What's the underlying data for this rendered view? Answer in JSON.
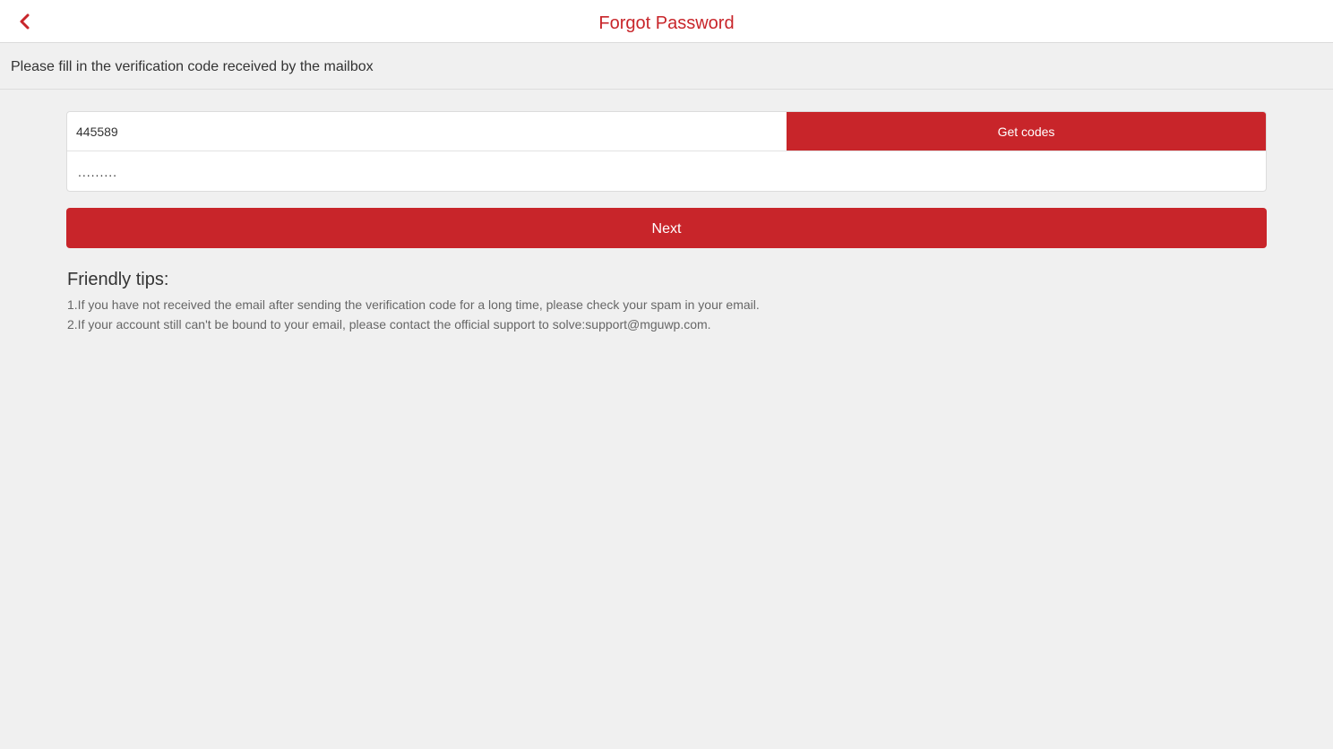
{
  "header": {
    "title": "Forgot Password",
    "back_icon": "chevron-left-icon",
    "accent_color": "#c8252a"
  },
  "subheader": {
    "text": "Please fill in the verification code received by the mailbox"
  },
  "form": {
    "code_value": "445589",
    "get_codes_label": "Get codes",
    "password_value": "........."
  },
  "next_label": "Next",
  "tips": {
    "title": "Friendly tips:",
    "items": [
      "1.If you have not received the email after sending the verification code for a long time, please check your spam in your email.",
      "2.If your account still can't be bound to your email, please contact the official support to solve:support@mguwp.com."
    ]
  }
}
